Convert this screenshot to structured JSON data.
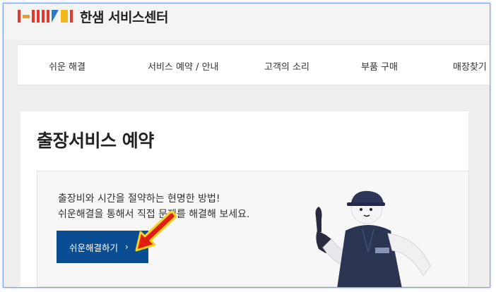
{
  "header": {
    "logo_text": "한샘 서비스센터",
    "logo_icon": "hanssem-logo-icon"
  },
  "nav": {
    "items": [
      "쉬운 해결",
      "서비스 예약 / 안내",
      "고객의 소리",
      "부품 구매",
      "매장찾기"
    ]
  },
  "main": {
    "title": "출장서비스 예약",
    "banner": {
      "line1": "출장비와 시간을 절약하는 현명한 방법!",
      "line2": "쉬운해결을 통해서 직접 문제를 해결해 보세요.",
      "button_label": "쉬운해결하기",
      "button_arrow": "›"
    }
  },
  "annotations": {
    "arrow_icon": "red-pointer-arrow-icon",
    "arrow_color": "#e21d0f",
    "arrow_outline_color": "#f5d31c"
  },
  "mascot_icon": "service-mascot-icon",
  "colors": {
    "accent": "#0a4d92",
    "frame_border": "#7da0e8"
  }
}
